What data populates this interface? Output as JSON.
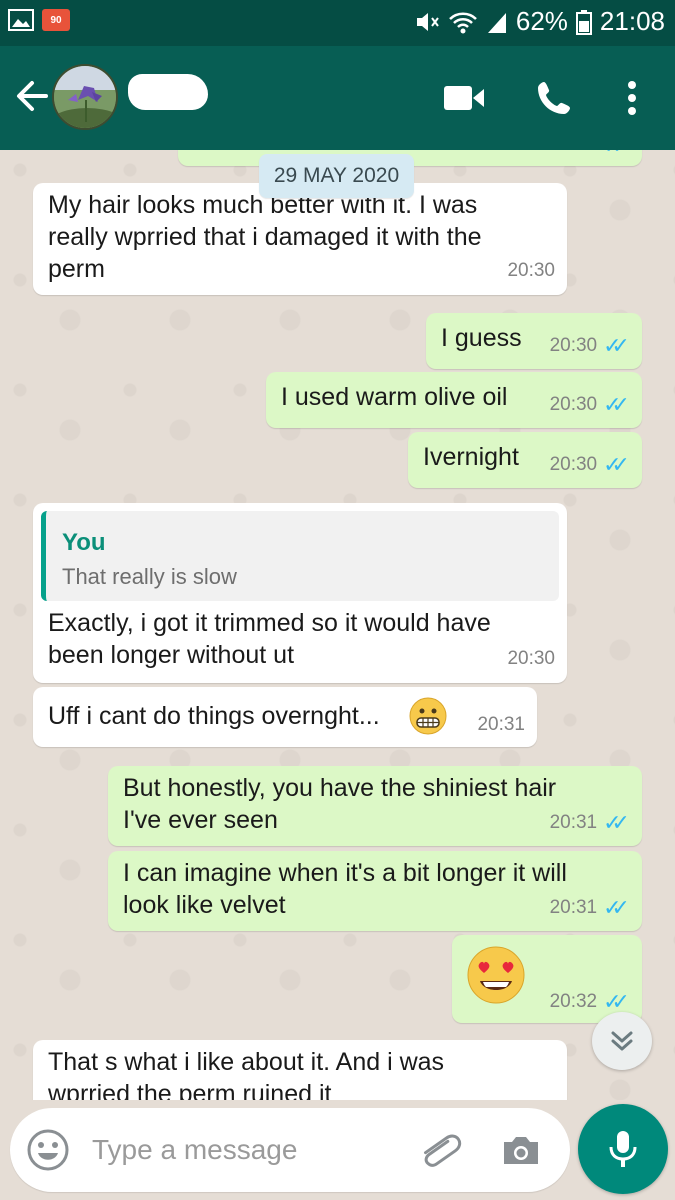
{
  "status_bar": {
    "notification_badge": "90",
    "battery": "62%",
    "time": "21:08"
  },
  "date_chip": "29 MAY 2020",
  "messages": [
    {
      "id": "m0",
      "text": "",
      "time": "",
      "ticks": "✓✓"
    },
    {
      "id": "m1",
      "lines": [
        "My hair looks much better with it. I was",
        "really wprried that i damaged it with the",
        "perm"
      ],
      "time": "20:30"
    },
    {
      "id": "m2",
      "text": "I guess",
      "time": "20:30",
      "ticks": "✓✓"
    },
    {
      "id": "m3",
      "text": "I used warm olive oil",
      "time": "20:30",
      "ticks": "✓✓"
    },
    {
      "id": "m4",
      "text": "Ivernight",
      "time": "20:30",
      "ticks": "✓✓"
    },
    {
      "id": "m5",
      "quote_author": "You",
      "quote_text": "That really is slow",
      "lines": [
        "Exactly, i got it trimmed so it would have",
        "been longer without ut"
      ],
      "time": "20:30"
    },
    {
      "id": "m6",
      "text": "Uff i cant do things overnght...",
      "time": "20:31"
    },
    {
      "id": "m7",
      "lines": [
        "But honestly, you have the shiniest hair",
        "I've ever seen"
      ],
      "time": "20:31",
      "ticks": "✓✓"
    },
    {
      "id": "m8",
      "lines": [
        "I can imagine when it's a bit longer it will",
        "look like velvet"
      ],
      "time": "20:31",
      "ticks": "✓✓"
    },
    {
      "id": "m9",
      "emoji": "😍",
      "time": "20:32",
      "ticks": "✓✓"
    },
    {
      "id": "m10",
      "lines": [
        "That s what i like about it. And i was",
        "wprried the perm ruined it"
      ]
    }
  ],
  "input": {
    "placeholder": "Type a message"
  },
  "icons": {
    "back": "arrow-left-icon",
    "video": "video-camera-icon",
    "call": "phone-icon",
    "more": "more-vertical-icon",
    "emoji": "emoji-icon",
    "attach": "paperclip-icon",
    "camera": "camera-icon",
    "mic": "microphone-icon",
    "scroll": "chevron-double-down-icon"
  },
  "colors": {
    "header": "#075e54",
    "status_bar": "#054d44",
    "outgoing_bubble": "#dcf8c6",
    "incoming_bubble": "#ffffff",
    "ticks": "#34b7f1",
    "fab": "#00897b"
  }
}
